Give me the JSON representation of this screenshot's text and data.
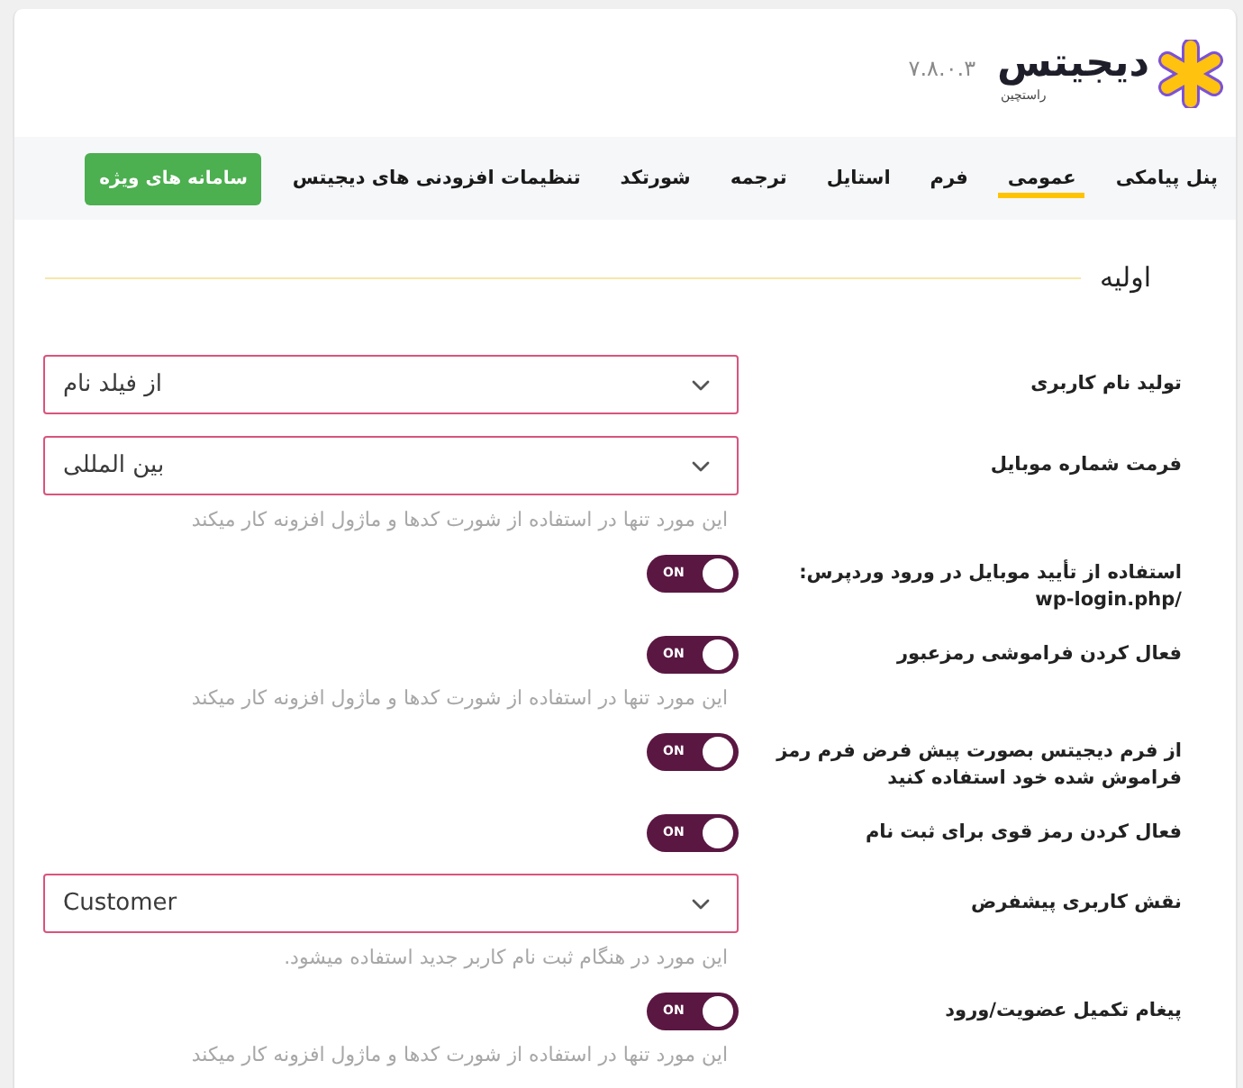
{
  "header": {
    "logo_text": "دیجیتس",
    "logo_subtitle": "راستچین",
    "version": "۷.۸.۰.۳"
  },
  "tabs": [
    {
      "label": "پنل پیامکی",
      "selected": false
    },
    {
      "label": "عمومی",
      "selected": true
    },
    {
      "label": "فرم",
      "selected": false
    },
    {
      "label": "استایل",
      "selected": false
    },
    {
      "label": "ترجمه",
      "selected": false
    },
    {
      "label": "شورتکد",
      "selected": false
    },
    {
      "label": "تنظیمات افزودنی های دیجیتس",
      "selected": false
    }
  ],
  "special_button": {
    "label": "سامانه های ویژه"
  },
  "section": {
    "title": "اولیه"
  },
  "settings": [
    {
      "kind": "select",
      "label": "تولید نام کاربری",
      "value": "از فیلد نام"
    },
    {
      "kind": "select",
      "label": "فرمت شماره موبایل",
      "value": "بین المللی",
      "help": "این مورد تنها در استفاده از شورت کدها و ماژول افزونه کار میکند"
    },
    {
      "kind": "toggle",
      "label": "استفاده از تأیید موبایل در ورود وردپرس: /wp-login.php",
      "on": true,
      "state_text": "ON"
    },
    {
      "kind": "toggle",
      "label": "فعال کردن فراموشی رمزعبور",
      "on": true,
      "state_text": "ON",
      "help": "این مورد تنها در استفاده از شورت کدها و ماژول افزونه کار میکند"
    },
    {
      "kind": "toggle",
      "label": "از فرم دیجیتس بصورت پیش فرض فرم رمز فراموش شده خود استفاده کنید",
      "on": true,
      "state_text": "ON"
    },
    {
      "kind": "toggle",
      "label": "فعال کردن رمز قوی برای ثبت نام",
      "on": true,
      "state_text": "ON"
    },
    {
      "kind": "select",
      "label": "نقش کاربری پیشفرض",
      "value": "Customer",
      "help": "این مورد در هنگام ثبت نام کاربر جدید استفاده میشود."
    },
    {
      "kind": "toggle",
      "label": "پیغام تکمیل عضویت/ورود",
      "on": true,
      "state_text": "ON",
      "help": "این مورد تنها در استفاده از شورت کدها و ماژول افزونه کار میکند"
    }
  ]
}
